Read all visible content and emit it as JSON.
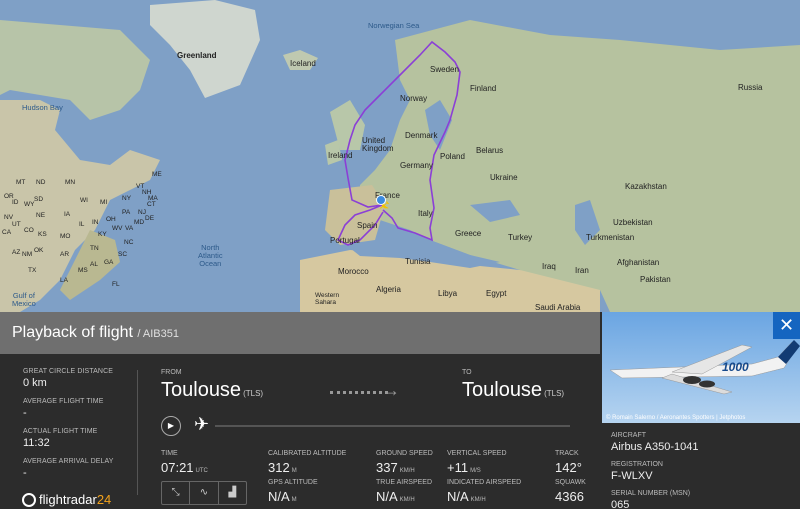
{
  "map": {
    "labels": {
      "greenland": "Greenland",
      "iceland": "Iceland",
      "norwegian_sea": "Norwegian Sea",
      "sweden": "Sweden",
      "finland": "Finland",
      "norway": "Norway",
      "russia": "Russia",
      "hudson_bay": "Hudson Bay",
      "denmark": "Denmark",
      "united_kingdom": "United\nKingdom",
      "ireland": "Ireland",
      "belarus": "Belarus",
      "poland": "Poland",
      "germany": "Germany",
      "ukraine": "Ukraine",
      "france": "France",
      "kazakhstan": "Kazakhstan",
      "italy": "Italy",
      "spain": "Spain",
      "portugal": "Portugal",
      "greece": "Greece",
      "turkey": "Turkey",
      "uzbekistan": "Uzbekistan",
      "turkmenistan": "Turkmenistan",
      "north_atlantic": "North\nAtlantic\nOcean",
      "morocco": "Morocco",
      "tunisia": "Tunisia",
      "iraq": "Iraq",
      "iran": "Iran",
      "afghanistan": "Afghanistan",
      "pakistan": "Pakistan",
      "algeria": "Algeria",
      "libya": "Libya",
      "egypt": "Egypt",
      "saudi_arabia": "Saudi Arabia",
      "western_sahara": "Western\nSahara",
      "gulf_of_mexico": "Gulf of\nMexico",
      "us_states": [
        "ND",
        "MN",
        "SD",
        "WI",
        "NE",
        "IA",
        "IL",
        "KS",
        "MO",
        "OK",
        "AR",
        "TX",
        "MS",
        "LA",
        "AL",
        "GA",
        "KY",
        "TN",
        "SC",
        "NC",
        "IN",
        "OH",
        "MI",
        "NY",
        "PA",
        "WV",
        "VA",
        "VT",
        "ME",
        "NH",
        "MA",
        "NJ",
        "CT",
        "MD",
        "DE",
        "FL",
        "OR",
        "CA",
        "NV",
        "ID",
        "MT",
        "WY",
        "UT",
        "CO",
        "AZ",
        "NM"
      ]
    },
    "colors": {
      "route": "#8b3fd6",
      "sea": "#7fa0c6",
      "land": "#d9d0c0"
    }
  },
  "panel": {
    "title": "Playback of flight",
    "subtitle": "/ AIB351",
    "stats": {
      "great_circle_label": "GREAT CIRCLE DISTANCE",
      "great_circle_value": "0 km",
      "avg_flight_time_label": "AVERAGE FLIGHT TIME",
      "avg_flight_time_value": "-",
      "actual_flight_time_label": "ACTUAL FLIGHT TIME",
      "actual_flight_time_value": "11:32",
      "avg_arrival_delay_label": "AVERAGE ARRIVAL DELAY",
      "avg_arrival_delay_value": "-"
    },
    "from_label": "FROM",
    "from_city": "Toulouse",
    "from_code": "(TLS)",
    "to_label": "TO",
    "to_city": "Toulouse",
    "to_code": "(TLS)",
    "route_arrow": "→",
    "play_icon": "▶",
    "plane_icon": "✈",
    "data": {
      "time_label": "TIME",
      "time_value": "07:21",
      "time_unit": "UTC",
      "cal_alt_label": "CALIBRATED ALTITUDE",
      "cal_alt_value": "312",
      "cal_alt_unit": "M",
      "gps_alt_label": "GPS ALTITUDE",
      "gps_alt_value": "N/A",
      "gps_alt_unit": "M",
      "ground_speed_label": "GROUND SPEED",
      "ground_speed_value": "337",
      "ground_speed_unit": "KM/H",
      "true_airspeed_label": "TRUE AIRSPEED",
      "true_airspeed_value": "N/A",
      "true_airspeed_unit": "KM/H",
      "vertical_speed_label": "VERTICAL SPEED",
      "vertical_speed_value": "+11",
      "vertical_speed_unit": "M/S",
      "ind_airspeed_label": "INDICATED AIRSPEED",
      "ind_airspeed_value": "N/A",
      "ind_airspeed_unit": "KM/H",
      "track_label": "TRACK",
      "track_value": "142°",
      "squawk_label": "SQUAWK",
      "squawk_value": "4366"
    },
    "controls": {
      "fit_icon": "⤡",
      "path_icon": "∿",
      "graph_icon": "▟"
    },
    "logo": {
      "name": "flightradar",
      "suffix": "24"
    }
  },
  "aircraft_panel": {
    "close_icon": "✕",
    "photo_credit": "© Romain Salerno / Aeronantes Spotters | Jetphotos",
    "aircraft_label": "AIRCRAFT",
    "aircraft_value": "Airbus A350-1041",
    "registration_label": "REGISTRATION",
    "registration_value": "F-WLXV",
    "serial_label": "SERIAL NUMBER (MSN)",
    "serial_value": "065",
    "photo_text": "1000"
  }
}
